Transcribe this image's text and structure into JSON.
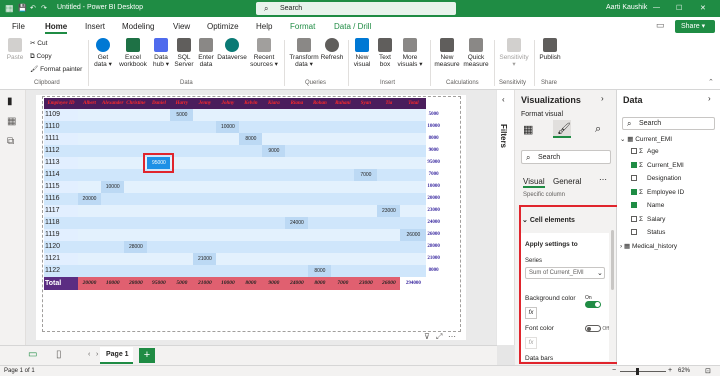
{
  "titlebar": {
    "doc_title": "Untitled - Power BI Desktop",
    "search": "Search",
    "user": "Aarti Kaushik"
  },
  "menu": [
    "File",
    "Home",
    "Insert",
    "Modeling",
    "View",
    "Optimize",
    "Help",
    "Format",
    "Data / Drill"
  ],
  "share": "Share",
  "ribbon": {
    "paste": "Paste",
    "cut": "Cut",
    "copy": "Copy",
    "format_painter": "Format painter",
    "get_data": "Get data",
    "excel": "Excel workbook",
    "data_hub": "Data hub",
    "sql": "SQL Server",
    "enter_data": "Enter data",
    "dataverse": "Dataverse",
    "recent": "Recent sources",
    "transform": "Transform data",
    "refresh": "Refresh",
    "new_visual": "New visual",
    "text_box": "Text box",
    "more_visuals": "More visuals",
    "new_measure": "New measure",
    "quick_measure": "Quick measure",
    "sensitivity": "Sensitivity",
    "publish": "Publish",
    "groups": [
      "Clipboard",
      "Data",
      "Queries",
      "Insert",
      "Calculations",
      "Sensitivity",
      "Share"
    ]
  },
  "matrix": {
    "headers": [
      "Employee ID",
      "Albert",
      "Alexander",
      "Christine",
      "Daniel",
      "Harry",
      "Jenny",
      "Johny",
      "Kelvin",
      "Kiara",
      "Riana",
      "Rohan",
      "Ruhani",
      "Syan",
      "Tia",
      "Total"
    ],
    "rows": [
      {
        "id": "1109",
        "cells": [
          "",
          "",
          "",
          "",
          "5000",
          "",
          "",
          "",
          "",
          "",
          "",
          "",
          "",
          "",
          ""
        ],
        "total": "5000"
      },
      {
        "id": "1110",
        "cells": [
          "",
          "",
          "",
          "",
          "",
          "",
          "10000",
          "",
          "",
          "",
          "",
          "",
          "",
          "",
          ""
        ],
        "total": "10000"
      },
      {
        "id": "1111",
        "cells": [
          "",
          "",
          "",
          "",
          "",
          "",
          "",
          "8000",
          "",
          "",
          "",
          "",
          "",
          "",
          ""
        ],
        "total": "8000"
      },
      {
        "id": "1112",
        "cells": [
          "",
          "",
          "",
          "",
          "",
          "",
          "",
          "",
          "9000",
          "",
          "",
          "",
          "",
          "",
          ""
        ],
        "total": "9000"
      },
      {
        "id": "1113",
        "cells": [
          "",
          "",
          "",
          "95000",
          "",
          "",
          "",
          "",
          "",
          "",
          "",
          "",
          "",
          "",
          ""
        ],
        "total": "95000"
      },
      {
        "id": "1114",
        "cells": [
          "",
          "",
          "",
          "",
          "",
          "",
          "",
          "",
          "",
          "",
          "",
          "",
          "7000",
          "",
          ""
        ],
        "total": "7000"
      },
      {
        "id": "1115",
        "cells": [
          "",
          "10000",
          "",
          "",
          "",
          "",
          "",
          "",
          "",
          "",
          "",
          "",
          "",
          "",
          ""
        ],
        "total": "10000"
      },
      {
        "id": "1116",
        "cells": [
          "20000",
          "",
          "",
          "",
          "",
          "",
          "",
          "",
          "",
          "",
          "",
          "",
          "",
          "",
          ""
        ],
        "total": "20000"
      },
      {
        "id": "1117",
        "cells": [
          "",
          "",
          "",
          "",
          "",
          "",
          "",
          "",
          "",
          "",
          "",
          "",
          "",
          "23000",
          ""
        ],
        "total": "23000"
      },
      {
        "id": "1118",
        "cells": [
          "",
          "",
          "",
          "",
          "",
          "",
          "",
          "",
          "",
          "24000",
          "",
          "",
          "",
          "",
          ""
        ],
        "total": "24000"
      },
      {
        "id": "1119",
        "cells": [
          "",
          "",
          "",
          "",
          "",
          "",
          "",
          "",
          "",
          "",
          "",
          "",
          "",
          "",
          "26000"
        ],
        "total": "26000"
      },
      {
        "id": "1120",
        "cells": [
          "",
          "",
          "28000",
          "",
          "",
          "",
          "",
          "",
          "",
          "",
          "",
          "",
          "",
          "",
          ""
        ],
        "total": "28000"
      },
      {
        "id": "1121",
        "cells": [
          "",
          "",
          "",
          "",
          "",
          "21000",
          "",
          "",
          "",
          "",
          "",
          "",
          "",
          "",
          ""
        ],
        "total": "21000"
      },
      {
        "id": "1122",
        "cells": [
          "",
          "",
          "",
          "",
          "",
          "",
          "",
          "",
          "",
          "",
          "8000",
          "",
          "",
          "",
          ""
        ],
        "total": "8000"
      }
    ],
    "total_label": "Total",
    "totals": [
      "20000",
      "10000",
      "28000",
      "95000",
      "5000",
      "21000",
      "10000",
      "8000",
      "9000",
      "24000",
      "8000",
      "7000",
      "23000",
      "26000"
    ],
    "grand_total": "294000",
    "colors": {
      "header_bg": "#4a1d5c",
      "header_text": "#ff2a2a",
      "id_bg": "#e2efff",
      "band_bg": "#cfe6fb",
      "cell_bg": "#e3f1fd",
      "highlight_bg": "#1e90e6",
      "highlight_border": "#e0242c",
      "total_bg": "#e06070",
      "total_label_bg": "#5b2d82",
      "total_col_text": "#3b2aa0"
    }
  },
  "filters": "Filters",
  "vis": {
    "title": "Visualizations",
    "subtitle": "Format visual",
    "search": "Search",
    "tab_visual": "Visual",
    "tab_general": "General",
    "partial": "Specific column",
    "section": "Cell elements",
    "apply": "Apply settings to",
    "series_label": "Series",
    "series_value": "Sum of Current_EMI",
    "bg_color": "Background color",
    "bg_state": "On",
    "font_color": "Font color",
    "font_state": "Off",
    "data_bars": "Data bars",
    "fx": "fx",
    "accent": "#1f8c44",
    "highlight": "#e0242c"
  },
  "data": {
    "title": "Data",
    "search": "Search",
    "table1": "Current_EMI",
    "fields": [
      {
        "name": "Age",
        "checked": false,
        "sigma": true
      },
      {
        "name": "Current_EMI",
        "checked": true,
        "sigma": true
      },
      {
        "name": "Designation",
        "checked": false,
        "sigma": false
      },
      {
        "name": "Employee ID",
        "checked": true,
        "sigma": true
      },
      {
        "name": "Name",
        "checked": true,
        "sigma": false
      },
      {
        "name": "Salary",
        "checked": false,
        "sigma": true
      },
      {
        "name": "Status",
        "checked": false,
        "sigma": false
      }
    ],
    "table2": "Medical_history"
  },
  "tabs": {
    "page1": "Page 1",
    "add": "+"
  },
  "status": {
    "page": "Page 1 of 1",
    "zoom": "62%"
  }
}
